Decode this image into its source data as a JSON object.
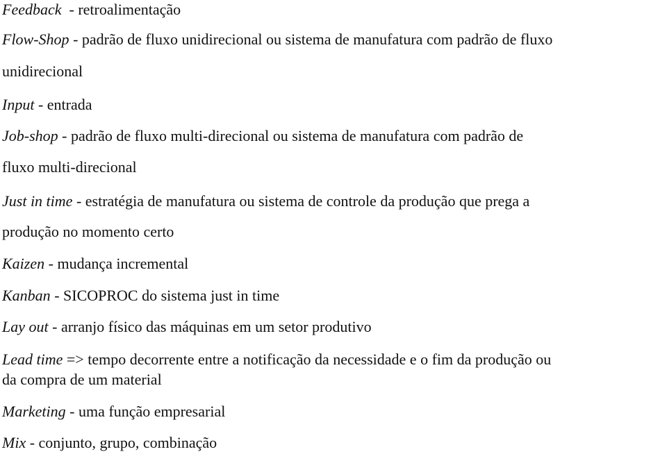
{
  "glossary": [
    {
      "term": "Feedback",
      "sep": "  - ",
      "definition": "retroalimentação"
    },
    {
      "term": "Flow-Shop",
      "sep": " - ",
      "definition": "padrão de fluxo unidirecional ou sistema de manufatura com padrão de fluxo",
      "continuation": "unidirecional"
    },
    {
      "term": "Input",
      "sep": " - ",
      "definition": "entrada"
    },
    {
      "term": "Job-shop",
      "sep": " - ",
      "definition": "padrão de fluxo multi-direcional ou sistema de manufatura com padrão de",
      "continuation": "fluxo multi-direcional"
    },
    {
      "term": "Just in time",
      "sep": " - ",
      "definition": "estratégia de manufatura ou sistema de controle da produção que prega a",
      "continuation": "produção no momento certo"
    },
    {
      "term": "Kaizen",
      "sep": " - ",
      "definition": "mudança incremental"
    },
    {
      "term": "Kanban",
      "sep": " - ",
      "definition": "SICOPROC do sistema just in time"
    },
    {
      "term": "Lay out",
      "sep": " - ",
      "definition": "arranjo físico das máquinas em um setor produtivo"
    },
    {
      "term": "Lead time",
      "sep": " => ",
      "definition": "tempo decorrente entre a notificação da necessidade e o fim da produção ou",
      "continuation": "da compra de um material"
    },
    {
      "term": "Marketing",
      "sep": " - ",
      "definition": "uma função empresarial"
    },
    {
      "term": "Mix",
      "sep": " - ",
      "definition": "conjunto, grupo, combinação"
    }
  ]
}
